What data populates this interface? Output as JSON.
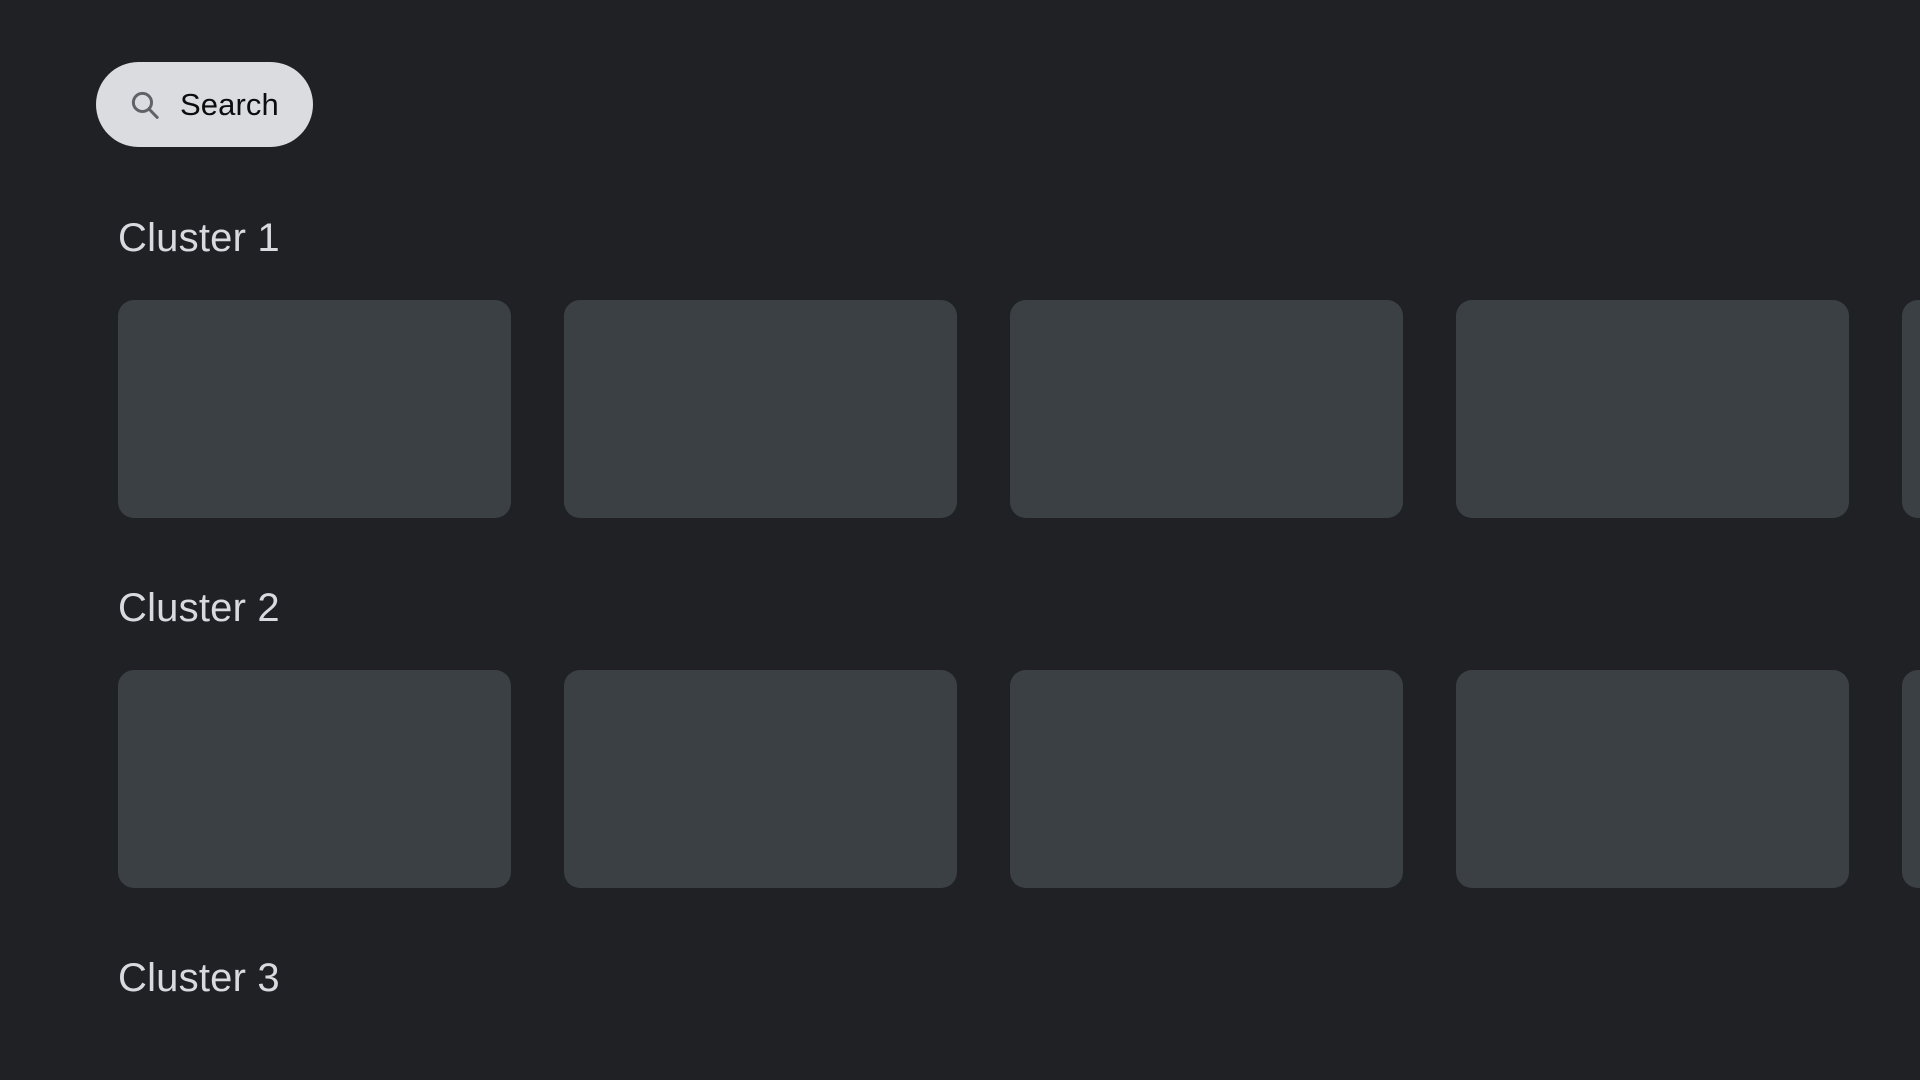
{
  "theme": {
    "background": "#202125",
    "card_fill": "#3B4044",
    "pill_fill": "#DADCE0",
    "pill_text": "#0d0d0f",
    "heading_text": "#d7dade",
    "icon_stroke": "#5f6368"
  },
  "search": {
    "label": "Search",
    "icon": "search-icon"
  },
  "clusters": [
    {
      "title": "Cluster 1",
      "cards": [
        {
          "id": "c1-card-1"
        },
        {
          "id": "c1-card-2"
        },
        {
          "id": "c1-card-3"
        },
        {
          "id": "c1-card-4"
        },
        {
          "id": "c1-card-5"
        }
      ]
    },
    {
      "title": "Cluster 2",
      "cards": [
        {
          "id": "c2-card-1"
        },
        {
          "id": "c2-card-2"
        },
        {
          "id": "c2-card-3"
        },
        {
          "id": "c2-card-4"
        },
        {
          "id": "c2-card-5"
        }
      ]
    },
    {
      "title": "Cluster 3",
      "cards": []
    }
  ]
}
